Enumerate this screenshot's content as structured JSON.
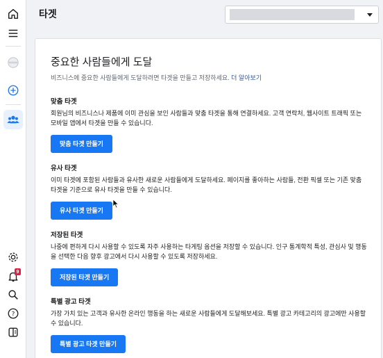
{
  "rail": {
    "items": [
      {
        "icon": "home-icon"
      },
      {
        "icon": "menu-icon"
      },
      {
        "icon": "account-avatar-icon"
      },
      {
        "icon": "add-icon"
      },
      {
        "icon": "audience-icon"
      }
    ],
    "bottom": [
      {
        "icon": "settings-icon"
      },
      {
        "icon": "notifications-icon",
        "badge": "9"
      },
      {
        "icon": "search-icon"
      },
      {
        "icon": "help-icon"
      },
      {
        "icon": "panel-icon"
      }
    ]
  },
  "header": {
    "title": "타겟"
  },
  "card": {
    "title": "중요한 사람들에게 도달",
    "subtitle": "비즈니스에 중요한 사람들에게 도달하려면 타겟을 만들고 저장하세요.",
    "learn_more": "더 알아보기",
    "sections": [
      {
        "heading": "맞춤 타겟",
        "body": "회원님의 비즈니스나 제품에 이미 관심을 보인 사람들과 맞춤 타겟을 통해 연결하세요. 고객 연락처, 웹사이트 트래픽 또는 모바일 앱에서 타겟을 만들 수 있습니다.",
        "button": "맞춤 타겟 만들기"
      },
      {
        "heading": "유사 타겟",
        "body": "이미 타겟에 포함된 사람들과 유사한 새로운 사람들에게 도달하세요. 페이지를 좋아하는 사람들, 전환 픽셀 또는 기존 맞춤 타겟을 기준으로 유사 타겟을 만들 수 있습니다.",
        "button": "유사 타겟 만들기"
      },
      {
        "heading": "저장된 타겟",
        "body": "나중에 편하게 다시 사용할 수 있도록 자주 사용하는 타게팅 옵션을 저장할 수 있습니다. 인구 통계학적 특성, 관심사 및 행동을 선택한 다음 향후 광고에서 다시 사용할 수 있도록 저장하세요.",
        "button": "저장된 타겟 만들기"
      },
      {
        "heading": "특별 광고 타겟",
        "body": "가장 가치 있는 고객과 유사한 온라인 행동을 하는 새로운 사람들에게 도달해보세요. 특별 광고 카테고리의 광고에만 사용할 수 있습니다.",
        "button": "특별 광고 타겟 만들기"
      }
    ]
  },
  "colors": {
    "accent": "#1877f2",
    "link": "#385898",
    "badge": "#e41e3f"
  }
}
